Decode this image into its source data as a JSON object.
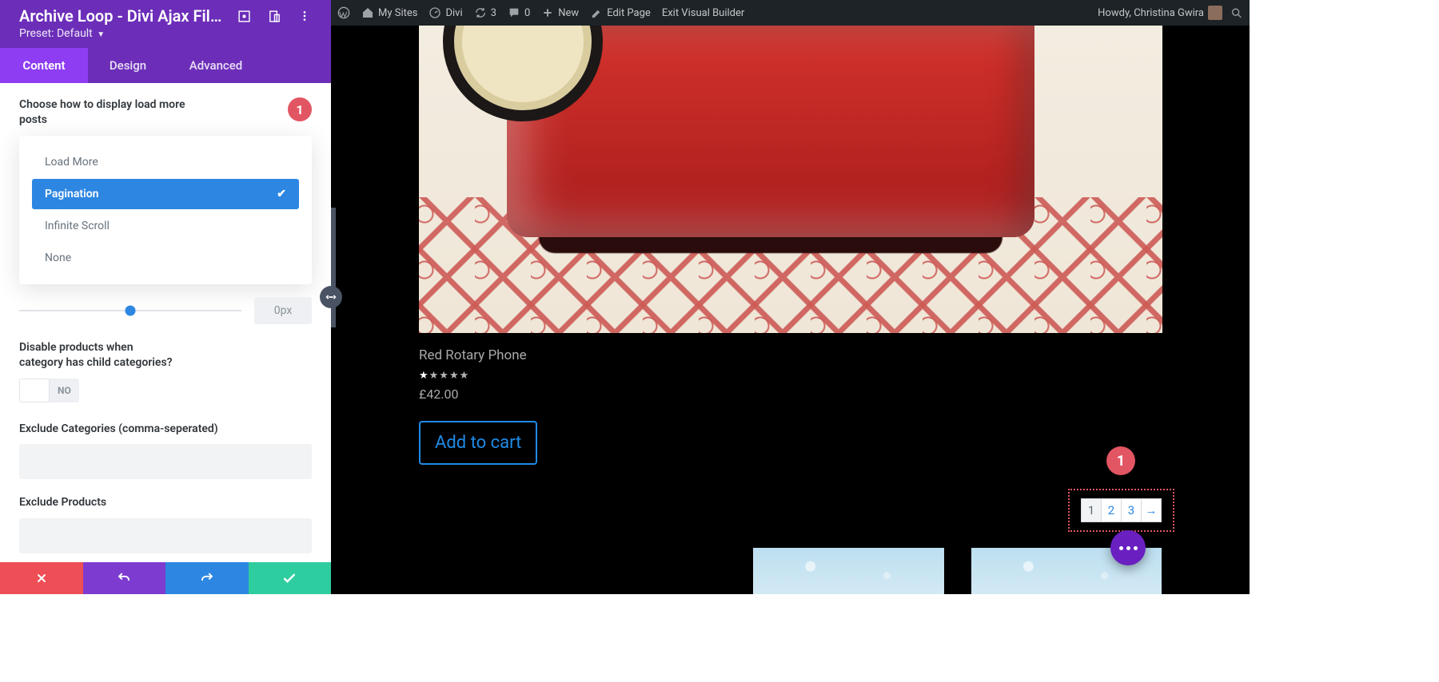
{
  "panel": {
    "title": "Archive Loop - Divi Ajax Filt...",
    "preset_prefix": "Preset: ",
    "preset_value": "Default",
    "tabs": [
      "Content",
      "Design",
      "Advanced"
    ],
    "active_tab": 0,
    "badge": "1"
  },
  "settings": {
    "display_mode": {
      "label": "Choose how to display load more posts",
      "options": [
        "Load More",
        "Pagination",
        "Infinite Scroll",
        "None"
      ],
      "selected": 1
    },
    "slider": {
      "value": "0px"
    },
    "disable_child": {
      "label": "Disable products when category has child categories?",
      "value": "NO"
    },
    "exclude_categories": {
      "label": "Exclude Categories (comma-seperated)",
      "value": ""
    },
    "exclude_products": {
      "label": "Exclude Products",
      "value": ""
    }
  },
  "adminbar": {
    "my_sites": "My Sites",
    "site": "Divi",
    "updates": "3",
    "comments": "0",
    "new": "New",
    "edit": "Edit Page",
    "exit_builder": "Exit Visual Builder",
    "howdy": "Howdy, Christina Gwira"
  },
  "product": {
    "title": "Red Rotary Phone",
    "rating": 1,
    "currency": "£",
    "price": "42.00",
    "add_to_cart": "Add to cart"
  },
  "pagination": {
    "pages": [
      "1",
      "2",
      "3",
      "→"
    ],
    "current": 0,
    "badge": "1"
  }
}
